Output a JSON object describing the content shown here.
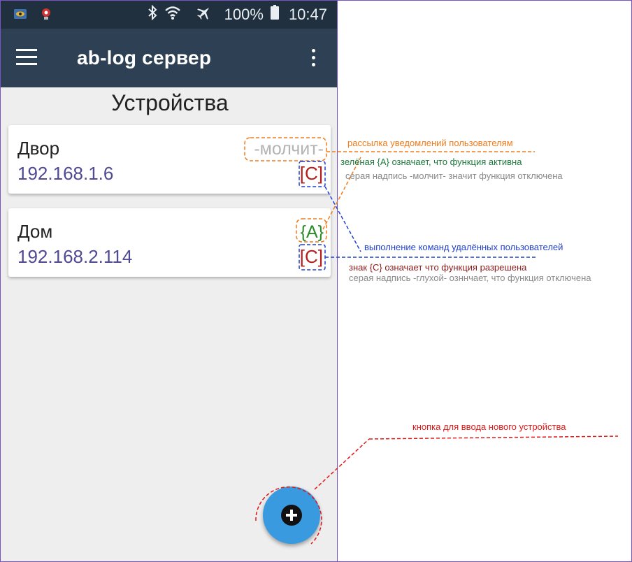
{
  "statusbar": {
    "battery": "100%",
    "time": "10:47"
  },
  "toolbar": {
    "title": "ab-log сервер"
  },
  "page": {
    "title": "Устройства"
  },
  "devices": [
    {
      "name": "Двор",
      "ip": "192.168.1.6",
      "notify": "-молчит-",
      "notify_color": "#b3b3b3",
      "command": "[C]"
    },
    {
      "name": "Дом",
      "ip": "192.168.2.114",
      "notify": "{A}",
      "notify_color": "#2a8a2a",
      "command": "[C]"
    }
  ],
  "annotations": {
    "notify_title": "рассылка уведомлений пользователям",
    "notify_active": "зелёная {A} означает, что функция активна",
    "notify_off": "серая надпись -молчит- значит функция отключена",
    "cmd_title": "выполнение команд удалённых пользователей",
    "cmd_allowed": "знак {C} означает что функция разрешена",
    "cmd_off": "серая надпись -глухой- озннчает, что функция отключена",
    "fab_label": "кнопка для ввода нового устройства"
  },
  "colors": {
    "statusbar": "#20303f",
    "toolbar": "#2e4053",
    "fab": "#3a9ae0",
    "orange": "#f07c1c",
    "blue": "#1f3fd0",
    "red": "#e01818"
  },
  "icons": [
    "hamburger-menu-icon",
    "overflow-menu-icon",
    "bluetooth-icon",
    "wifi-icon",
    "airplane-icon",
    "battery-icon",
    "add-icon"
  ]
}
